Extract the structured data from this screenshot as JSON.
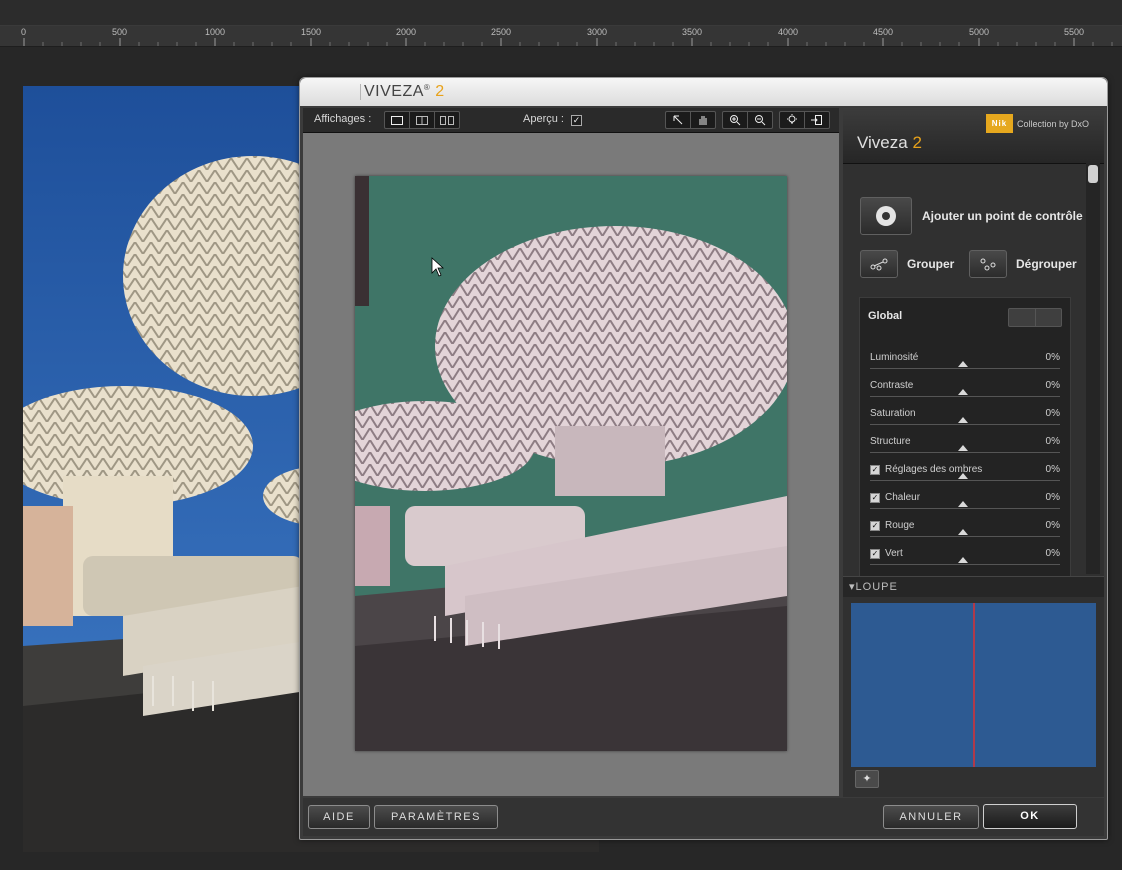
{
  "ruler": {
    "ticks": [
      "0",
      "500",
      "1000",
      "1500",
      "2000",
      "2500",
      "3000",
      "3500",
      "4000",
      "4500",
      "5000",
      "5500"
    ]
  },
  "dialog": {
    "title": "VIVEZA",
    "title_reg": "®",
    "title_version": "2",
    "toolbar": {
      "views_label": "Affichages :",
      "preview_label": "Aperçu :",
      "preview_checked": "✓"
    },
    "buttons": {
      "help": "AIDE",
      "settings": "PARAMÈTRES",
      "cancel": "ANNULER",
      "ok": "OK"
    }
  },
  "panel": {
    "logo_text": "Nik",
    "collection": "Collection by DxO",
    "title": "Viveza",
    "title_version": "2",
    "add_point": "Ajouter un point de contrôle",
    "group": "Grouper",
    "ungroup": "Dégrouper",
    "global_title": "Global",
    "sliders": [
      {
        "name": "Luminosité",
        "value": "0%",
        "checkbox": false
      },
      {
        "name": "Contraste",
        "value": "0%",
        "checkbox": false
      },
      {
        "name": "Saturation",
        "value": "0%",
        "checkbox": false
      },
      {
        "name": "Structure",
        "value": "0%",
        "checkbox": false
      },
      {
        "name": "Réglages des ombres",
        "value": "0%",
        "checkbox": true
      },
      {
        "name": "Chaleur",
        "value": "0%",
        "checkbox": true
      },
      {
        "name": "Rouge",
        "value": "0%",
        "checkbox": true
      },
      {
        "name": "Vert",
        "value": "0%",
        "checkbox": true
      }
    ],
    "loupe_label": "LOUPE"
  },
  "colors": {
    "accent": "#e8a21a",
    "loupe_bg": "#2d5a92"
  }
}
